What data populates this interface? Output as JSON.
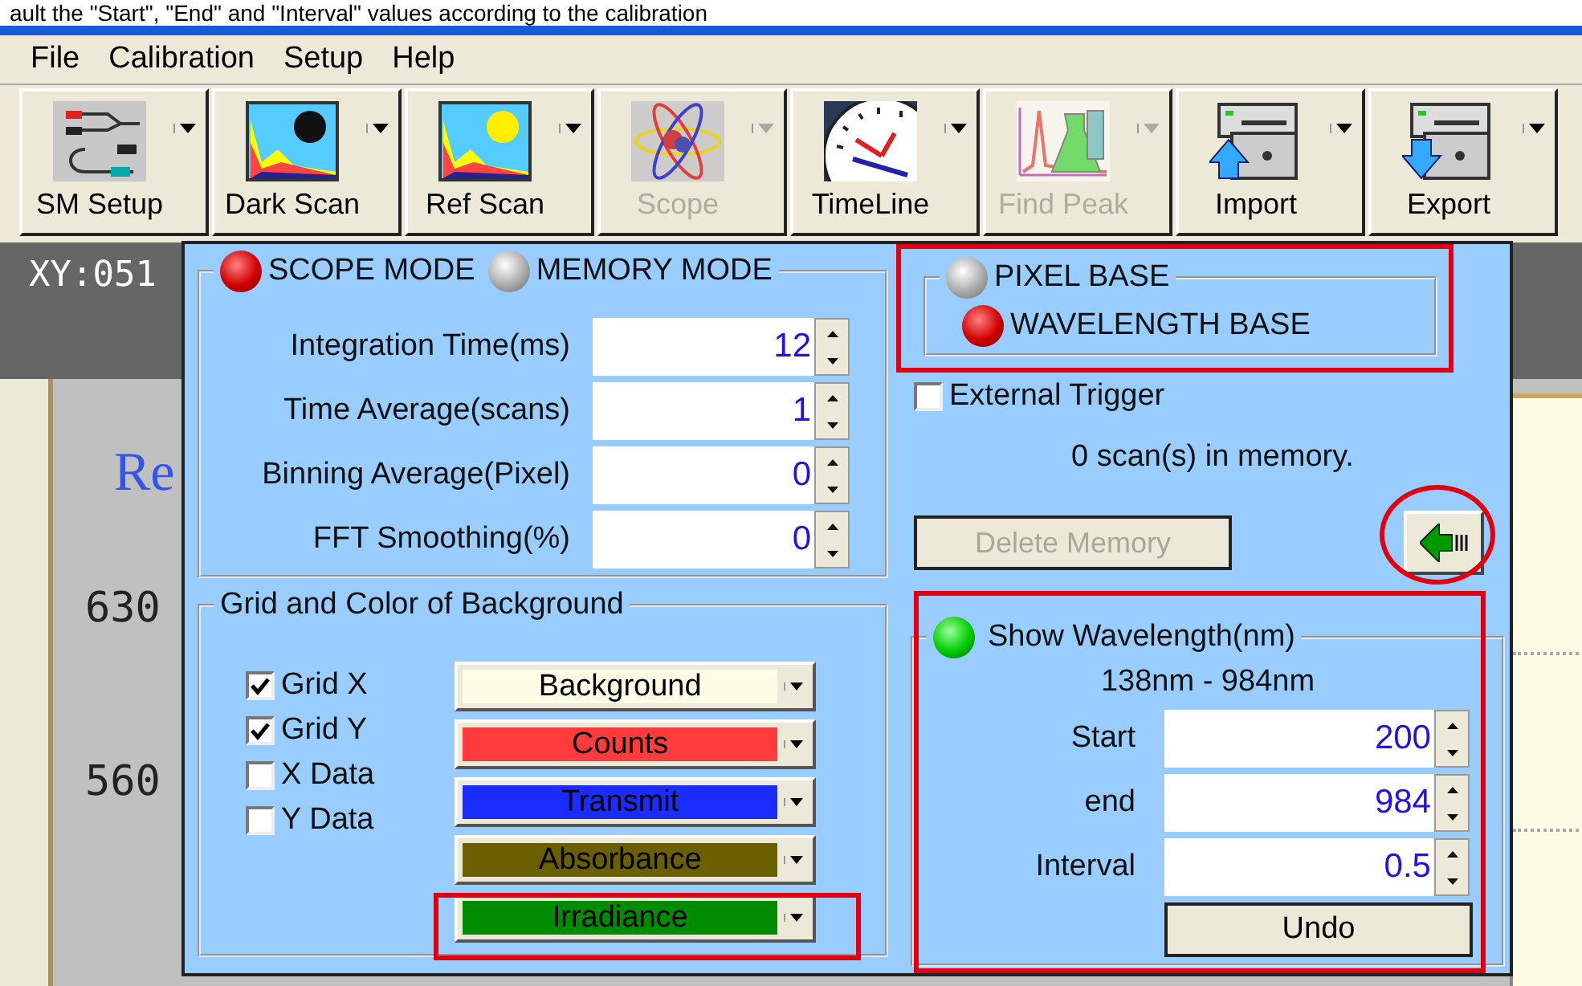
{
  "caption": "ault the \"Start\", \"End\" and \"Interval\" values according to the calibration",
  "menu": [
    "File",
    "Calibration",
    "Setup",
    "Help"
  ],
  "toolbar": [
    {
      "label": "SM Setup",
      "disabled": false
    },
    {
      "label": "Dark Scan",
      "disabled": false
    },
    {
      "label": "Ref Scan",
      "disabled": false
    },
    {
      "label": "Scope",
      "disabled": true
    },
    {
      "label": "TimeLine",
      "disabled": false
    },
    {
      "label": "Find Peak",
      "disabled": true
    },
    {
      "label": "Import",
      "disabled": false
    },
    {
      "label": "Export",
      "disabled": false
    }
  ],
  "background": {
    "coordinates": "XY:051",
    "chart_title": "Re",
    "y_labels": [
      "630",
      "560"
    ]
  },
  "dialog": {
    "modes": [
      {
        "label": "SCOPE MODE",
        "selected": true
      },
      {
        "label": "MEMORY MODE",
        "selected": false
      }
    ],
    "parameters": [
      {
        "label": "Integration Time(ms)",
        "value": "12"
      },
      {
        "label": "Time Average(scans)",
        "value": "1"
      },
      {
        "label": "Binning Average(Pixel)",
        "value": "0"
      },
      {
        "label": "FFT Smoothing(%)",
        "value": "0"
      }
    ],
    "grid_group": {
      "title": "Grid and Color of Background",
      "options": [
        {
          "label": "Grid X",
          "checked": true
        },
        {
          "label": "Grid Y",
          "checked": true
        },
        {
          "label": "X Data",
          "checked": false
        },
        {
          "label": "Y Data",
          "checked": false
        }
      ],
      "colors": [
        {
          "label": "Background",
          "color": "#fdfde6"
        },
        {
          "label": "Counts",
          "color": "#ff3b3b"
        },
        {
          "label": "Transmit",
          "color": "#1a2cff"
        },
        {
          "label": "Absorbance",
          "color": "#6b6000"
        },
        {
          "label": "Irradiance",
          "color": "#008c00"
        }
      ]
    },
    "bases": [
      {
        "label": "PIXEL BASE",
        "selected": false
      },
      {
        "label": "WAVELENGTH BASE",
        "selected": true
      }
    ],
    "external_trigger": {
      "label": "External Trigger",
      "checked": false
    },
    "memory_status": "0 scan(s) in memory.",
    "delete_button": {
      "label": "Delete Memory",
      "disabled": true
    },
    "wavelength": {
      "title": "Show Wavelength(nm)",
      "on": true,
      "range": "138nm - 984nm",
      "fields": [
        {
          "label": "Start",
          "value": "200"
        },
        {
          "label": "end",
          "value": "984"
        },
        {
          "label": "Interval",
          "value": "0.5"
        }
      ],
      "undo": "Undo"
    }
  }
}
